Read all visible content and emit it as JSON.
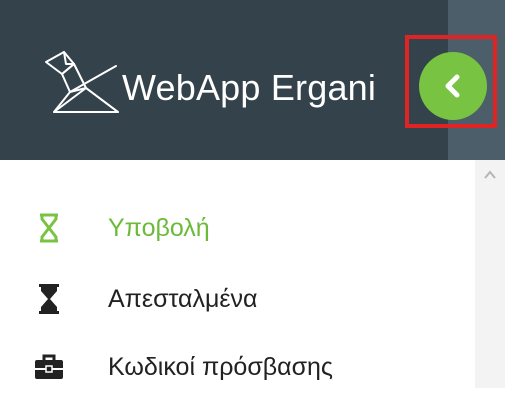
{
  "header": {
    "app_title": "WebApp Ergani",
    "logo_icon": "origami-bird-icon",
    "collapse_icon": "chevron-left-icon",
    "colors": {
      "header_bg": "#34434b",
      "accent": "#79c342",
      "highlight": "#e02424"
    }
  },
  "menu": {
    "items": [
      {
        "label": "Υποβολή",
        "icon": "hourglass-outline-icon",
        "active": true
      },
      {
        "label": "Απεσταλμένα",
        "icon": "hourglass-filled-icon",
        "active": false
      },
      {
        "label": "Κωδικοί πρόσβασης",
        "icon": "briefcase-icon",
        "active": false
      }
    ]
  }
}
